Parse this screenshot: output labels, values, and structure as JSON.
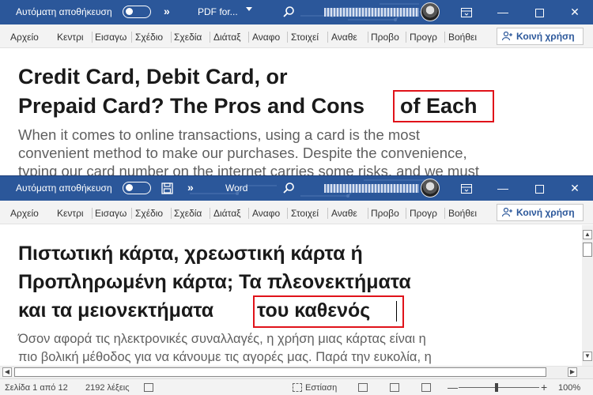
{
  "colors": {
    "titlebar": "#2b579a",
    "highlight": "#e0131a",
    "heading": "#1a1a1a",
    "body": "#5f5f5f"
  },
  "window_top": {
    "autosave_label": "Αυτόματη αποθήκευση",
    "doc_title": "PDF for...",
    "ribbon_tabs": [
      "Αρχείο",
      "Κεντρι",
      "Εισαγω",
      "Σχέδιο",
      "Σχεδία",
      "Διάταξ",
      "Αναφο",
      "Στοιχεί",
      "Αναθε",
      "Προβο",
      "Προγρ",
      "Βοήθει"
    ],
    "share_label": "Κοινή χρήση",
    "heading_line1": "Credit Card, Debit Card, or",
    "heading_line2_pre": "Prepaid Card? The Pros and Cons",
    "heading_line2_highlight": "of Each",
    "body_lines": [
      "When it comes to online transactions, using a card is the most",
      "convenient method to make our purchases. Despite the convenience,",
      "typing our card number on the internet carries some risks, and we must"
    ]
  },
  "window_bottom": {
    "autosave_label": "Αυτόματη αποθήκευση",
    "doc_title": "Word",
    "ribbon_tabs": [
      "Αρχείο",
      "Κεντρι",
      "Εισαγω",
      "Σχέδιο",
      "Σχεδία",
      "Διάταξ",
      "Αναφο",
      "Στοιχεί",
      "Αναθε",
      "Προβο",
      "Προγρ",
      "Βοήθει"
    ],
    "share_label": "Κοινή χρήση",
    "heading_line1": "Πιστωτική κάρτα, χρεωστική κάρτα ή",
    "heading_line2": "Προπληρωμένη κάρτα; Τα πλεονεκτήματα",
    "heading_line3_pre": "και τα μειονεκτήματα",
    "heading_line3_highlight": "του καθενός",
    "body_lines": [
      "Όσον αφορά τις ηλεκτρονικές συναλλαγές, η χρήση μιας κάρτας είναι η",
      "πιο βολική μέθοδος για να κάνουμε τις αγορές μας. Παρά την ευκολία, η"
    ],
    "status": {
      "page": "Σελίδα 1 από 12",
      "words": "2192 λέξεις",
      "focus": "Εστίαση",
      "zoom": "100%"
    }
  }
}
